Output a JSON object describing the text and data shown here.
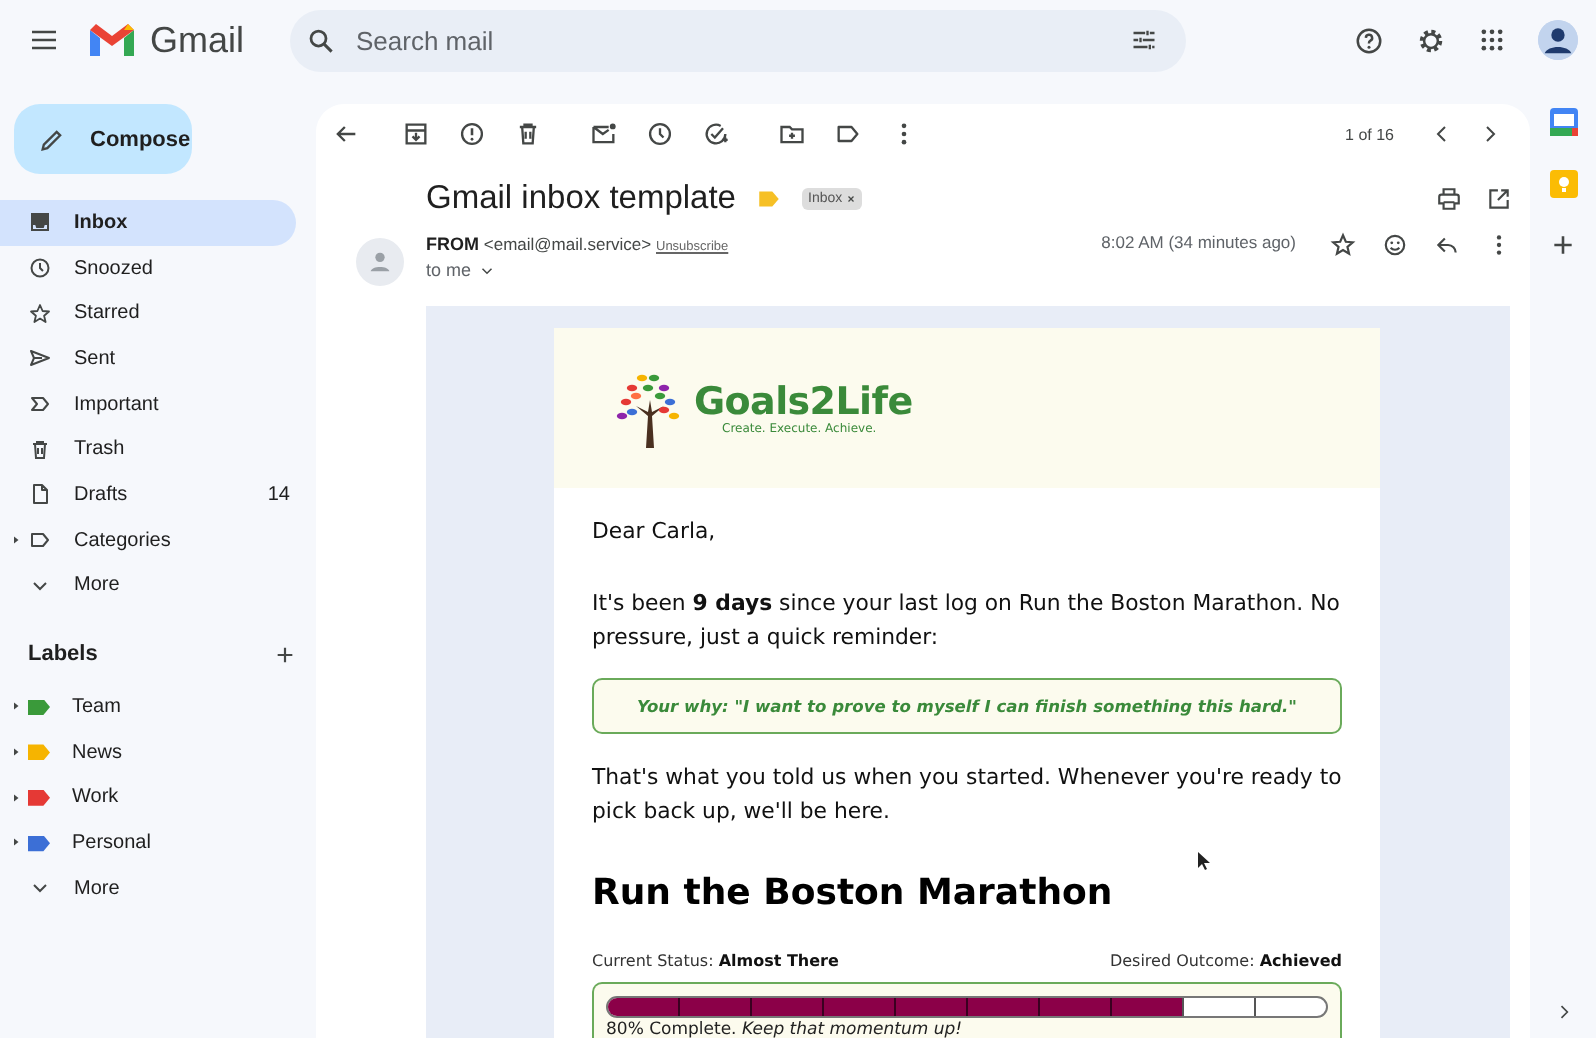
{
  "header": {
    "app_name": "Gmail",
    "search": {
      "placeholder": "Search mail"
    }
  },
  "compose": {
    "label": "Compose"
  },
  "nav": [
    {
      "kind": "inbox",
      "label": "Inbox",
      "selected": true,
      "expandable": false
    },
    {
      "kind": "snoozed",
      "label": "Snoozed",
      "selected": false,
      "expandable": false
    },
    {
      "kind": "starred",
      "label": "Starred",
      "selected": false,
      "expandable": false
    },
    {
      "kind": "sent",
      "label": "Sent",
      "selected": false,
      "expandable": false
    },
    {
      "kind": "important",
      "label": "Important",
      "selected": false,
      "expandable": false
    },
    {
      "kind": "trash",
      "label": "Trash",
      "selected": false,
      "expandable": false
    },
    {
      "kind": "drafts",
      "label": "Drafts",
      "count": "14",
      "selected": false,
      "expandable": false
    },
    {
      "kind": "categories",
      "label": "Categories",
      "selected": false,
      "expandable": true
    },
    {
      "kind": "more",
      "label": "More",
      "selected": false,
      "expandable": false
    }
  ],
  "labels": {
    "title": "Labels",
    "items": [
      {
        "kind": "label",
        "label": "Team",
        "color": "#3a9a3a",
        "expandable": true
      },
      {
        "kind": "label",
        "label": "News",
        "color": "#f6b400",
        "expandable": true
      },
      {
        "kind": "label",
        "label": "Work",
        "color": "#e53935",
        "expandable": true
      },
      {
        "kind": "label",
        "label": "Personal",
        "color": "#3c6fd6",
        "expandable": true
      },
      {
        "kind": "more",
        "label": "More",
        "expandable": false
      }
    ]
  },
  "toolbar": {
    "pagination": "1 of 16"
  },
  "message": {
    "subject": "Gmail inbox template",
    "important": true,
    "chip": "Inbox",
    "from": "FROM",
    "email": "<email@mail.service>",
    "unsubscribe": "Unsubscribe",
    "to": "to me",
    "time": "8:02 AM (34 minutes ago)",
    "starred": false
  },
  "email": {
    "brand": "Goals2Life",
    "tagline": "Create. Execute. Achieve.",
    "greeting": "Dear Carla,",
    "paragraph_1": "It's been **9 days** since your last log on Run the Boston Marathon. No pressure, just a quick reminder:",
    "why": "Your why: \"I want to prove to myself I can finish something this hard.\"",
    "paragraph_2": "That's what you told us when you started. Whenever you're ready to pick back up, we'll be here.",
    "goal_title": "Run the Boston Marathon",
    "status_label": "Current Status:",
    "status_value": "Almost There",
    "outcome_label": "Desired Outcome:",
    "outcome_value": "Achieved",
    "progress": {
      "level": 0.8,
      "text": "80% Complete. *Keep that momentum up!*"
    }
  }
}
